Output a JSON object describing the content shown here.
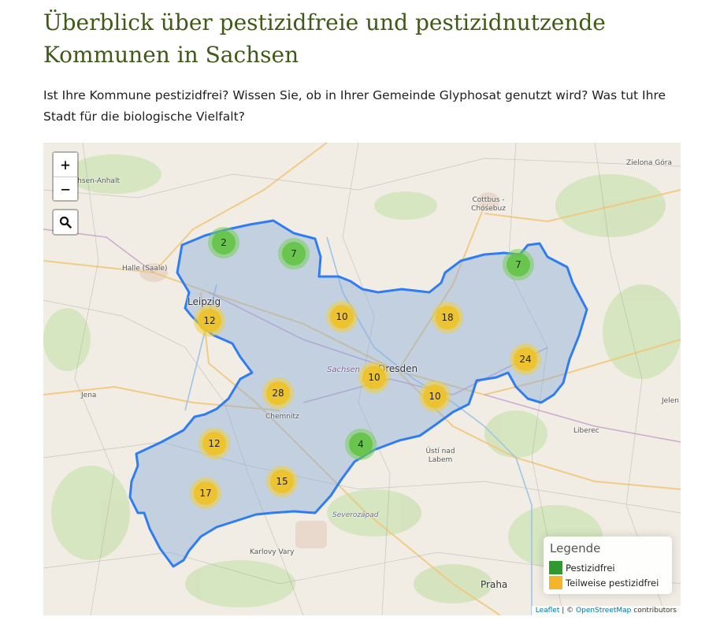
{
  "page": {
    "title": "Überblick über pestizidfreie und pestizidnutzende Kommunen in Sachsen",
    "intro": "Ist Ihre Kommune pestizidfrei? Wissen Sie, ob in Ihrer Gemeinde Glyphosat genutzt wird? Was tut Ihre Stadt für die biologische Vielfalt?"
  },
  "map": {
    "controls": {
      "zoom_in": "+",
      "zoom_out": "−",
      "search_icon": "search-icon"
    },
    "places": {
      "sachsen_anhalt": "Sachsen-Anhalt",
      "zielona_gora": "Zielona Góra",
      "cottbus": "Cottbus - Chóśebuz",
      "halle": "Halle (Saale)",
      "leipzig": "Leipzig",
      "jena": "Jena",
      "sachsen": "Sachsen",
      "dresden": "Dresden",
      "chemnitz": "Chemnitz",
      "jelen": "Jelen",
      "liberec": "Liberec",
      "usti": "Ústí nad Labem",
      "severozapad": "Severozápad",
      "karlovy_vary": "Karlovy Vary",
      "praha": "Praha"
    },
    "clusters": [
      {
        "count": "2",
        "status": "pestizidfrei"
      },
      {
        "count": "7",
        "status": "pestizidfrei"
      },
      {
        "count": "7",
        "status": "pestizidfrei"
      },
      {
        "count": "12",
        "status": "teilweise"
      },
      {
        "count": "10",
        "status": "teilweise"
      },
      {
        "count": "18",
        "status": "teilweise"
      },
      {
        "count": "24",
        "status": "teilweise"
      },
      {
        "count": "10",
        "status": "teilweise"
      },
      {
        "count": "28",
        "status": "teilweise"
      },
      {
        "count": "10",
        "status": "teilweise"
      },
      {
        "count": "12",
        "status": "teilweise"
      },
      {
        "count": "4",
        "status": "pestizidfrei"
      },
      {
        "count": "17",
        "status": "teilweise"
      },
      {
        "count": "15",
        "status": "teilweise"
      }
    ],
    "legend": {
      "title": "Legende",
      "items": [
        {
          "label": "Pestizidfrei",
          "color": "#2e9a2e"
        },
        {
          "label": "Teilweise pestizidfrei",
          "color": "#f4b52a"
        }
      ]
    },
    "attribution": {
      "leaflet": "Leaflet",
      "sep": " | © ",
      "osm": "OpenStreetMap",
      "contributors": " contributors"
    },
    "colors": {
      "state_fill": "#a9c6e6",
      "state_border": "#2f7df0"
    }
  }
}
